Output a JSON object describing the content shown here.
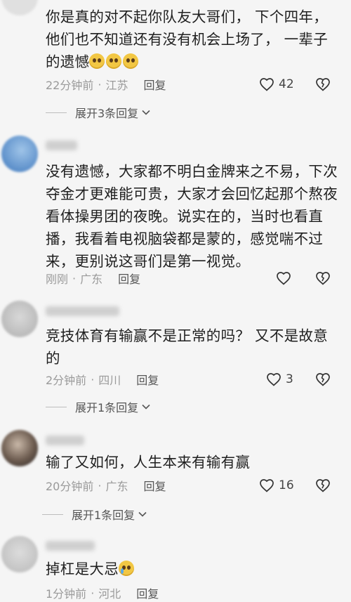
{
  "comments": [
    {
      "text": "你是真的对不起你队友大哥们， 下个四年，他们也不知道还有没有机会上场了， 一辈子的遗憾",
      "time": "22分钟前",
      "location": "江苏",
      "reply": "回复",
      "likes": "42",
      "expand": "展开3条回复"
    },
    {
      "text": "没有遗憾，大家都不明白金牌来之不易，下次夺金才更难能可贵，大家才会回忆起那个熬夜看体操男团的夜晚。说实在的，当时也看直播，我看着电视脑袋都是蒙的，感觉喘不过来，更别说这哥们是第一视觉。",
      "time": "刚刚",
      "location": "广东",
      "reply": "回复"
    },
    {
      "text": "竞技体育有输赢不是正常的吗？ 又不是故意的",
      "time": "2分钟前",
      "location": "四川",
      "reply": "回复",
      "likes": "3",
      "expand": "展开1条回复"
    },
    {
      "text": "输了又如何，人生本来有输有赢",
      "time": "20分钟前",
      "location": "广东",
      "reply": "回复",
      "likes": "16",
      "expand": "展开1条回复"
    },
    {
      "text": "掉杠是大忌",
      "time": "1分钟前",
      "location": "河北",
      "reply": "回复"
    }
  ],
  "icons": {
    "like": "heart-outline-icon",
    "dislike": "broken-heart-icon",
    "expand": "chevron-down-icon"
  },
  "colors": {
    "background": "#f5f5f5",
    "meta": "#9a9a9a",
    "text": "#1f1f1f"
  }
}
